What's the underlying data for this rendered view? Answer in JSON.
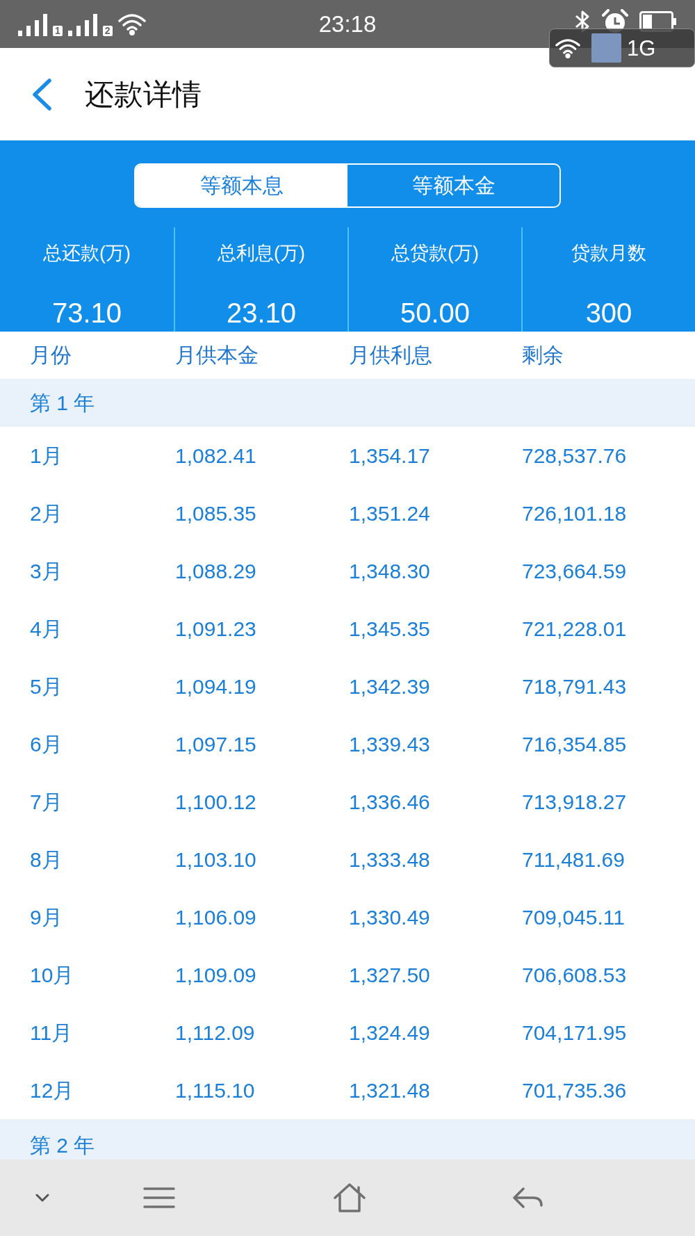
{
  "status_bar": {
    "sim_slots": [
      "1",
      "2"
    ],
    "time": "23:18"
  },
  "floating_panel": {
    "network": "1G"
  },
  "header": {
    "title": "还款详情"
  },
  "tabs": [
    {
      "label": "等额本息",
      "selected": true
    },
    {
      "label": "等额本金",
      "selected": false
    }
  ],
  "summary": [
    {
      "label": "总还款(万)",
      "value": "73.10"
    },
    {
      "label": "总利息(万)",
      "value": "23.10"
    },
    {
      "label": "总贷款(万)",
      "value": "50.00"
    },
    {
      "label": "贷款月数",
      "value": "300"
    }
  ],
  "table": {
    "columns": [
      "月份",
      "月供本金",
      "月供利息",
      "剩余"
    ],
    "groups": [
      {
        "title": "第 1 年",
        "rows": [
          [
            "1月",
            "1,082.41",
            "1,354.17",
            "728,537.76"
          ],
          [
            "2月",
            "1,085.35",
            "1,351.24",
            "726,101.18"
          ],
          [
            "3月",
            "1,088.29",
            "1,348.30",
            "723,664.59"
          ],
          [
            "4月",
            "1,091.23",
            "1,345.35",
            "721,228.01"
          ],
          [
            "5月",
            "1,094.19",
            "1,342.39",
            "718,791.43"
          ],
          [
            "6月",
            "1,097.15",
            "1,339.43",
            "716,354.85"
          ],
          [
            "7月",
            "1,100.12",
            "1,336.46",
            "713,918.27"
          ],
          [
            "8月",
            "1,103.10",
            "1,333.48",
            "711,481.69"
          ],
          [
            "9月",
            "1,106.09",
            "1,330.49",
            "709,045.11"
          ],
          [
            "10月",
            "1,109.09",
            "1,327.50",
            "706,608.53"
          ],
          [
            "11月",
            "1,112.09",
            "1,324.49",
            "704,171.95"
          ],
          [
            "12月",
            "1,115.10",
            "1,321.48",
            "701,735.36"
          ]
        ]
      },
      {
        "title": "第 2 年"
      }
    ]
  }
}
